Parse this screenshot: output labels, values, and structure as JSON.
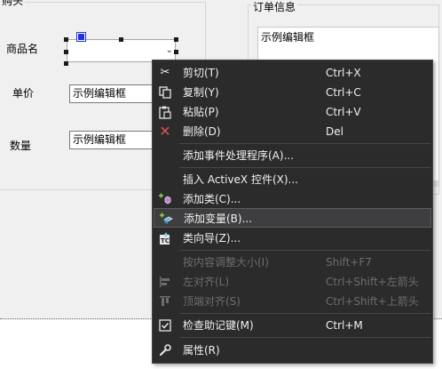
{
  "dialog": {
    "left_group_title": "购头",
    "right_group_title": "订单信息",
    "labels": {
      "product_name": "商品名",
      "unit_price": "单价",
      "quantity": "数量"
    },
    "fields": {
      "unit_price_value": "示例编辑框",
      "quantity_value": "示例编辑框"
    },
    "order_info_text": "示例编辑框"
  },
  "context_menu": {
    "items": [
      {
        "label": "剪切(T)",
        "shortcut": "Ctrl+X",
        "icon": "scissors-icon",
        "disabled": false
      },
      {
        "label": "复制(Y)",
        "shortcut": "Ctrl+C",
        "icon": "copy-icon",
        "disabled": false
      },
      {
        "label": "粘贴(P)",
        "shortcut": "Ctrl+V",
        "icon": "paste-icon",
        "disabled": false
      },
      {
        "label": "删除(D)",
        "shortcut": "Del",
        "icon": "delete-icon",
        "disabled": false
      },
      {
        "label": "添加事件处理程序(A)...",
        "shortcut": "",
        "icon": "",
        "disabled": false
      },
      {
        "label": "插入 ActiveX 控件(X)...",
        "shortcut": "",
        "icon": "",
        "disabled": false
      },
      {
        "label": "添加类(C)...",
        "shortcut": "",
        "icon": "add-class-icon",
        "disabled": false
      },
      {
        "label": "添加变量(B)...",
        "shortcut": "",
        "icon": "add-variable-icon",
        "disabled": false,
        "highlighted": true
      },
      {
        "label": "类向导(Z)...",
        "shortcut": "",
        "icon": "class-wizard-icon",
        "disabled": false
      },
      {
        "label": "按内容调整大小(I)",
        "shortcut": "Shift+F7",
        "icon": "",
        "disabled": true
      },
      {
        "label": "左对齐(L)",
        "shortcut": "Ctrl+Shift+左箭头",
        "icon": "align-left-icon",
        "disabled": true
      },
      {
        "label": "顶端对齐(S)",
        "shortcut": "Ctrl+Shift+上箭头",
        "icon": "align-top-icon",
        "disabled": true
      },
      {
        "label": "检查助记键(M)",
        "shortcut": "Ctrl+M",
        "icon": "check-mnemonics-icon",
        "disabled": false
      },
      {
        "label": "属性(R)",
        "shortcut": "",
        "icon": "properties-icon",
        "disabled": false
      }
    ]
  }
}
